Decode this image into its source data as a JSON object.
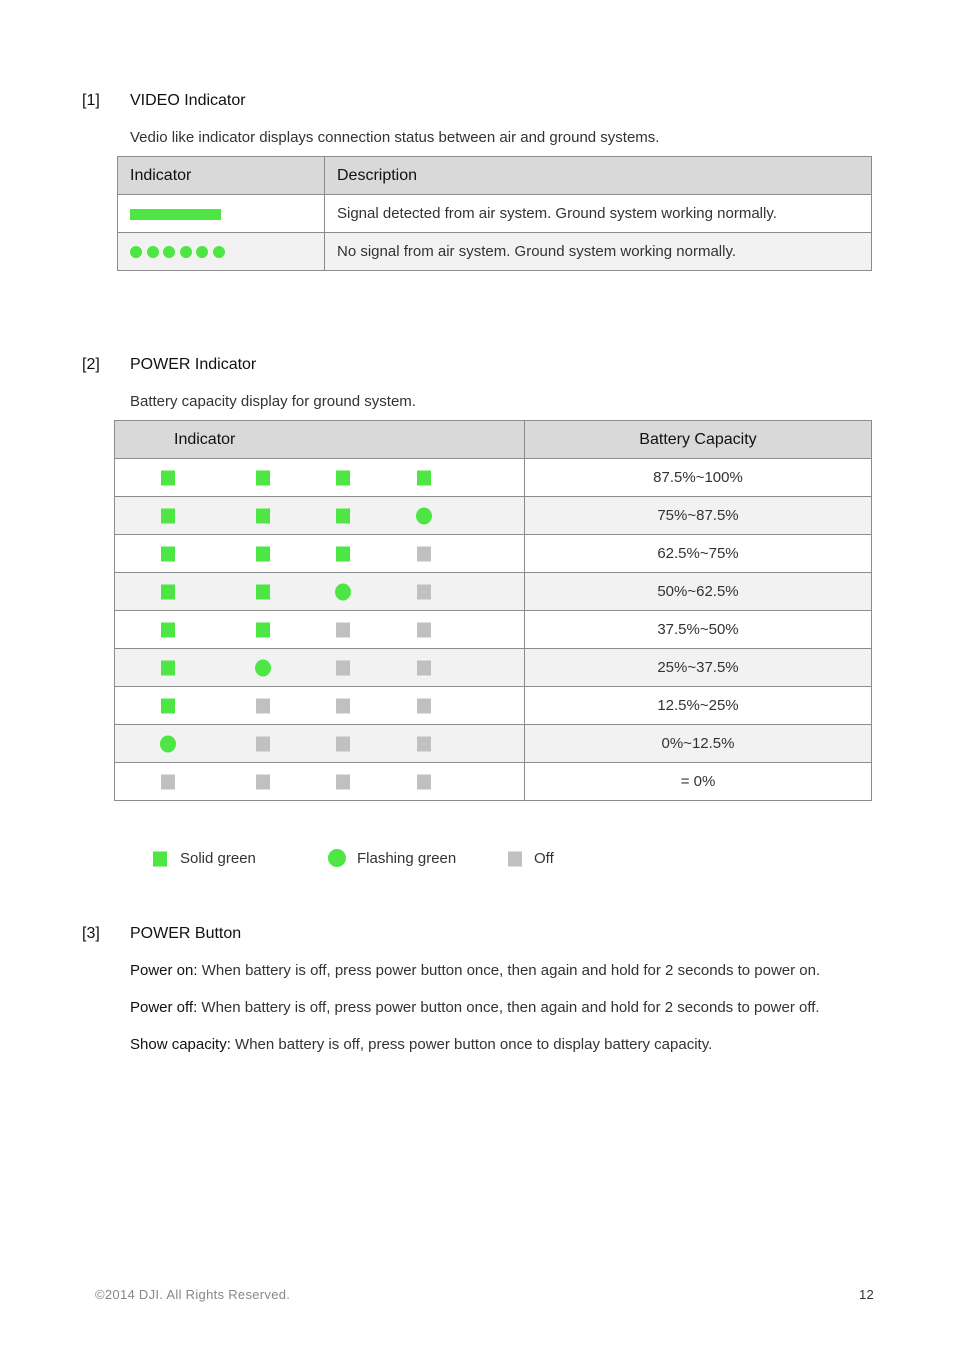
{
  "sections": [
    {
      "number": "[1]",
      "title": "VIDEO Indicator",
      "description": "Vedio like indicator displays connection status between air and ground systems.",
      "table": {
        "headers": [
          "Indicator",
          "Description"
        ],
        "rows": [
          {
            "indicator": "solid-bar",
            "description": "Signal detected from air system. Ground system working normally."
          },
          {
            "indicator": "six-dots",
            "description": "No signal from air system. Ground system working normally."
          }
        ]
      }
    },
    {
      "number": "[2]",
      "title": "POWER Indicator",
      "description": "Battery capacity display for ground system.",
      "table": {
        "headers": [
          "Indicator",
          "Battery Capacity"
        ],
        "rows": [
          {
            "leds": [
              "solid",
              "solid",
              "solid",
              "solid"
            ],
            "capacity": "87.5%~100%"
          },
          {
            "leds": [
              "solid",
              "solid",
              "solid",
              "flash"
            ],
            "capacity": "75%~87.5%"
          },
          {
            "leds": [
              "solid",
              "solid",
              "solid",
              "off"
            ],
            "capacity": "62.5%~75%"
          },
          {
            "leds": [
              "solid",
              "solid",
              "flash",
              "off"
            ],
            "capacity": "50%~62.5%"
          },
          {
            "leds": [
              "solid",
              "solid",
              "off",
              "off"
            ],
            "capacity": "37.5%~50%"
          },
          {
            "leds": [
              "solid",
              "flash",
              "off",
              "off"
            ],
            "capacity": "25%~37.5%"
          },
          {
            "leds": [
              "solid",
              "off",
              "off",
              "off"
            ],
            "capacity": "12.5%~25%"
          },
          {
            "leds": [
              "flash",
              "off",
              "off",
              "off"
            ],
            "capacity": "0%~12.5%"
          },
          {
            "leds": [
              "off",
              "off",
              "off",
              "off"
            ],
            "capacity": "= 0%"
          }
        ]
      },
      "legend": [
        {
          "type": "solid",
          "label": "Solid green"
        },
        {
          "type": "flash",
          "label": "Flashing green"
        },
        {
          "type": "off",
          "label": "Off"
        }
      ]
    },
    {
      "number": "[3]",
      "title": "POWER Button",
      "items": [
        {
          "label": "Power on:",
          "text": " When battery is off, press power button once, then again and hold for 2 seconds to power on."
        },
        {
          "label": "Power off:",
          "text": " When battery is off, press power button once, then again and hold for 2 seconds to power off."
        },
        {
          "label": "Show capacity:",
          "text": " When battery is off, press power button once to display battery capacity."
        }
      ]
    }
  ],
  "colors": {
    "solid_green": "#4de644",
    "off_gray": "#c0c0c0",
    "header_bg": "#d9d9d9",
    "alt_row_bg": "#f2f2f2"
  },
  "footer": {
    "copyright": "©2014  DJI.  All  Rights  Reserved.",
    "page_number": "12"
  }
}
